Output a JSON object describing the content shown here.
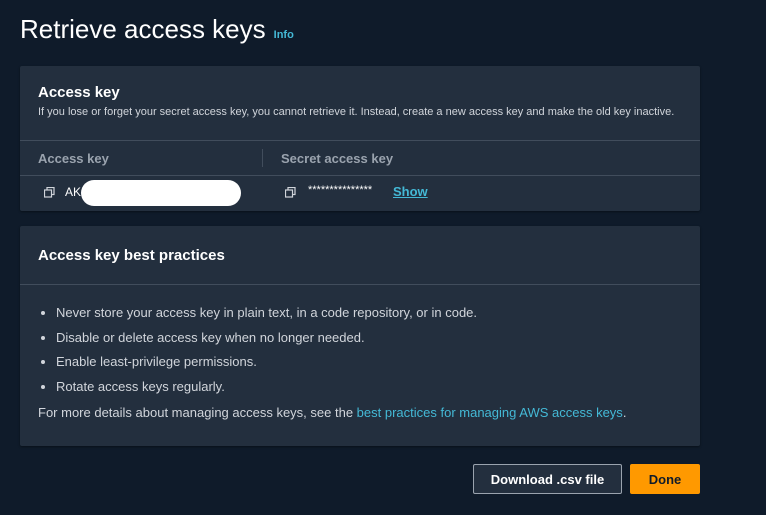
{
  "header": {
    "title": "Retrieve access keys",
    "info_link": "Info"
  },
  "access_key_card": {
    "title": "Access key",
    "description": "If you lose or forget your secret access key, you cannot retrieve it. Instead, create a new access key and make the old key inactive.",
    "columns": [
      "Access key",
      "Secret access key"
    ],
    "row": {
      "access_key_prefix": "AKI",
      "secret_masked": "***************",
      "show_label": "Show"
    }
  },
  "best_practices_card": {
    "title": "Access key best practices",
    "items": [
      "Never store your access key in plain text, in a code repository, or in code.",
      "Disable or delete access key when no longer needed.",
      "Enable least-privilege permissions.",
      "Rotate access keys regularly."
    ],
    "more_text": "For more details about managing access keys, see the ",
    "more_link": "best practices for managing AWS access keys",
    "more_suffix": "."
  },
  "actions": {
    "download_label": "Download .csv file",
    "done_label": "Done"
  },
  "colors": {
    "background": "#0f1b2a",
    "card": "#232f3e",
    "link": "#44b9d6",
    "primary": "#ff9900"
  }
}
